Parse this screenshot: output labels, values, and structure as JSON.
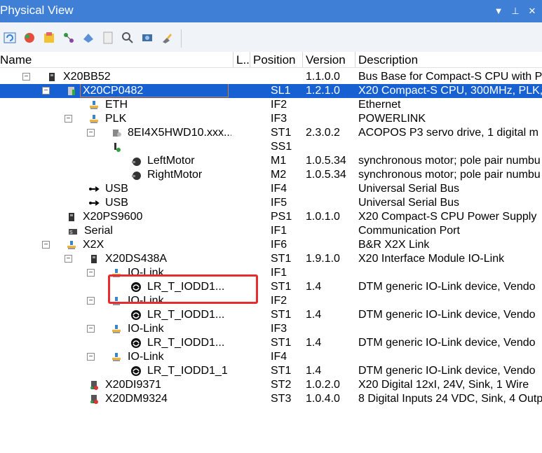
{
  "panel": {
    "title": "Physical View"
  },
  "toolbar_icons": [
    "refresh-icon",
    "module-icon",
    "library-icon",
    "network-icon",
    "properties-icon",
    "document-icon",
    "search-icon",
    "settings-icon",
    "pin-icon"
  ],
  "columns": {
    "name": "Name",
    "l": "L..",
    "position": "Position",
    "version": "Version",
    "description": "Description"
  },
  "rows": [
    {
      "name": "X20BB52",
      "position": "",
      "version": "1.1.0.0",
      "description": "Bus Base for Compact-S CPU with P"
    },
    {
      "name": "X20CP0482",
      "position": "SL1",
      "version": "1.2.1.0",
      "description": "X20 Compact-S CPU, 300MHz, PLK,"
    },
    {
      "name": "ETH",
      "position": "IF2",
      "version": "",
      "description": "Ethernet"
    },
    {
      "name": "PLK",
      "position": "IF3",
      "version": "",
      "description": "POWERLINK"
    },
    {
      "name": "8EI4X5HWD10.xxx...",
      "position": "ST1",
      "version": "2.3.0.2",
      "description": "ACOPOS P3 servo drive, 1 digital m"
    },
    {
      "name": "",
      "position": "SS1",
      "version": "",
      "description": ""
    },
    {
      "name": "LeftMotor",
      "position": "M1",
      "version": "1.0.5.34",
      "description": "synchronous motor; pole pair numbu"
    },
    {
      "name": "RightMotor",
      "position": "M2",
      "version": "1.0.5.34",
      "description": "synchronous motor; pole pair numbu"
    },
    {
      "name": "USB",
      "position": "IF4",
      "version": "",
      "description": "Universal Serial Bus"
    },
    {
      "name": "USB",
      "position": "IF5",
      "version": "",
      "description": "Universal Serial Bus"
    },
    {
      "name": "X20PS9600",
      "position": "PS1",
      "version": "1.0.1.0",
      "description": "X20 Compact-S CPU Power Supply"
    },
    {
      "name": "Serial",
      "position": "IF1",
      "version": "",
      "description": "Communication Port"
    },
    {
      "name": "X2X",
      "position": "IF6",
      "version": "",
      "description": "B&R X2X Link"
    },
    {
      "name": "X20DS438A",
      "position": "ST1",
      "version": "1.9.1.0",
      "description": "X20 Interface Module IO-Link"
    },
    {
      "name": "IO-Link",
      "position": "IF1",
      "version": "",
      "description": ""
    },
    {
      "name": "LR_T_IODD1...",
      "position": "ST1",
      "version": "1.4",
      "description": "DTM generic IO-Link device, Vendo"
    },
    {
      "name": "IO-Link",
      "position": "IF2",
      "version": "",
      "description": ""
    },
    {
      "name": "LR_T_IODD1...",
      "position": "ST1",
      "version": "1.4",
      "description": "DTM generic IO-Link device, Vendo"
    },
    {
      "name": "IO-Link",
      "position": "IF3",
      "version": "",
      "description": ""
    },
    {
      "name": "LR_T_IODD1...",
      "position": "ST1",
      "version": "1.4",
      "description": "DTM generic IO-Link device, Vendo"
    },
    {
      "name": "IO-Link",
      "position": "IF4",
      "version": "",
      "description": ""
    },
    {
      "name": "LR_T_IODD1_1",
      "position": "ST1",
      "version": "1.4",
      "description": "DTM generic IO-Link device, Vendo"
    },
    {
      "name": "X20DI9371",
      "position": "ST2",
      "version": "1.0.2.0",
      "description": "X20 Digital 12xI, 24V, Sink, 1 Wire"
    },
    {
      "name": "X20DM9324",
      "position": "ST3",
      "version": "1.0.4.0",
      "description": "8 Digital Inputs 24 VDC, Sink, 4 Outp"
    }
  ]
}
